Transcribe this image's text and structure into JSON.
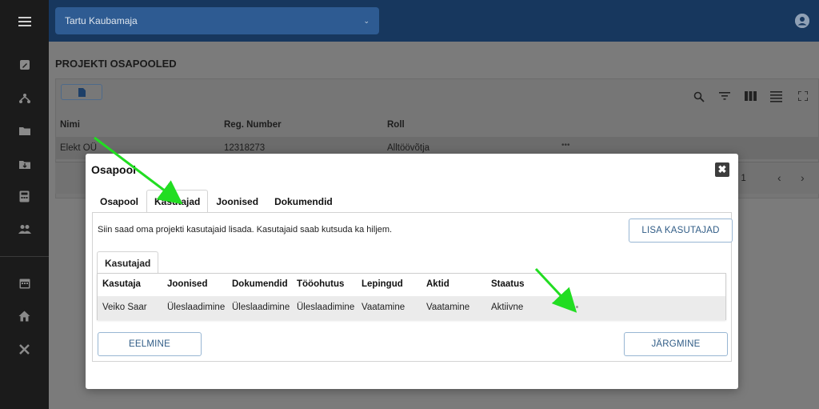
{
  "app": {
    "project_select": "Tartu Kaubamaja"
  },
  "sidebar": {
    "items": [
      {
        "icon": "menu-icon"
      },
      {
        "icon": "edit-icon"
      },
      {
        "icon": "network-icon"
      },
      {
        "icon": "folder-icon"
      },
      {
        "icon": "folder-download-icon"
      },
      {
        "icon": "calculator-icon"
      },
      {
        "icon": "people-icon"
      },
      {
        "icon": "calendar-icon"
      },
      {
        "icon": "house-icon"
      },
      {
        "icon": "tools-icon"
      }
    ]
  },
  "page": {
    "title": "PROJEKTI OSAPOOLED",
    "columns": [
      "Nimi",
      "Reg. Number",
      "Roll"
    ],
    "row": {
      "name": "Elekt OÜ",
      "reg": "12318273",
      "role": "Alltöövõtja",
      "more": "•••"
    },
    "pager": "/ 1"
  },
  "modal": {
    "title": "Osapool",
    "close_label": "✖",
    "tabs": [
      "Osapool",
      "Kasutajad",
      "Joonised",
      "Dokumendid"
    ],
    "active_tab": "Kasutajad",
    "info_text": "Siin saad oma projekti kasutajaid lisada. Kasutajaid saab kutsuda ka hiljem.",
    "add_users_button": "LISA KASUTAJAD",
    "inner_tab": "Kasutajad",
    "table": {
      "headers": [
        "Kasutaja",
        "Joonised",
        "Dokumendid",
        "Tööohutus",
        "Lepingud",
        "Aktid",
        "Staatus"
      ],
      "rows": [
        [
          "Veiko Saar",
          "Üleslaadimine",
          "Üleslaadimine",
          "Üleslaadimine",
          "Vaatamine",
          "Vaatamine",
          "Aktiivne"
        ]
      ]
    },
    "prev_button": "EELMINE",
    "next_button": "JÄRGMINE"
  },
  "colors": {
    "topbar": "#17375e",
    "accent": "#305c86",
    "annotation_arrow": "#22dd22"
  }
}
